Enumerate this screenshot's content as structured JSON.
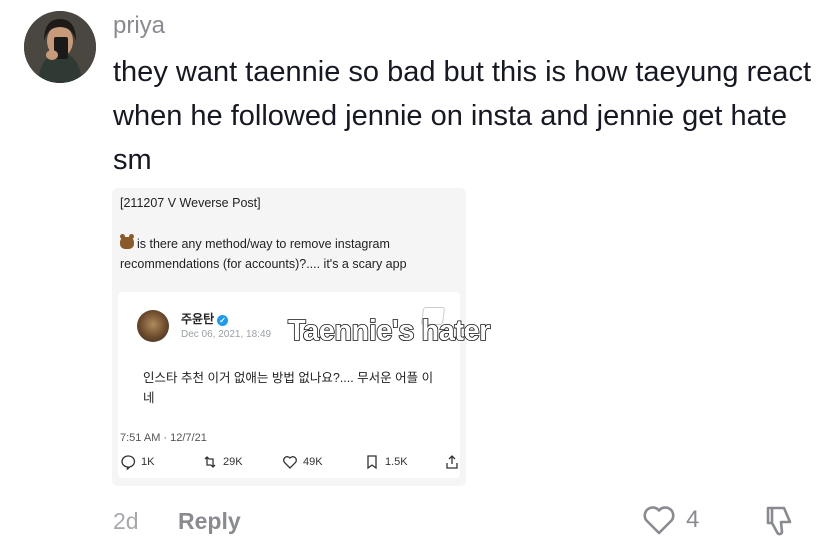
{
  "comment": {
    "username": "priya",
    "text": "they want taennie so bad but this is how taeyung react when he followed jennie on insta and jennie get hate sm",
    "time_ago": "2d",
    "reply_label": "Reply",
    "like_count": "4"
  },
  "attachment": {
    "post_tag": "[211207 V Weverse Post]",
    "post_body": "is there any method/way to remove instagram recommendations (for accounts)?.... it's a scary app",
    "tweet": {
      "author": "주윤탄",
      "date": "Dec 06, 2021, 18:49",
      "text": "인스타 추천 이거 없애는 방법 없나요?.... 무서운 어플 이네",
      "timestamp": "7:51 AM · 12/7/21",
      "replies": "1K",
      "retweets": "29K",
      "likes": "49K",
      "bookmarks": "1.5K"
    },
    "overlay_text": "Taennie's hater"
  },
  "colors": {
    "username": "#8a8b91",
    "text": "#161823",
    "muted": "#a7a8ad",
    "verified": "#1d9bf0"
  }
}
